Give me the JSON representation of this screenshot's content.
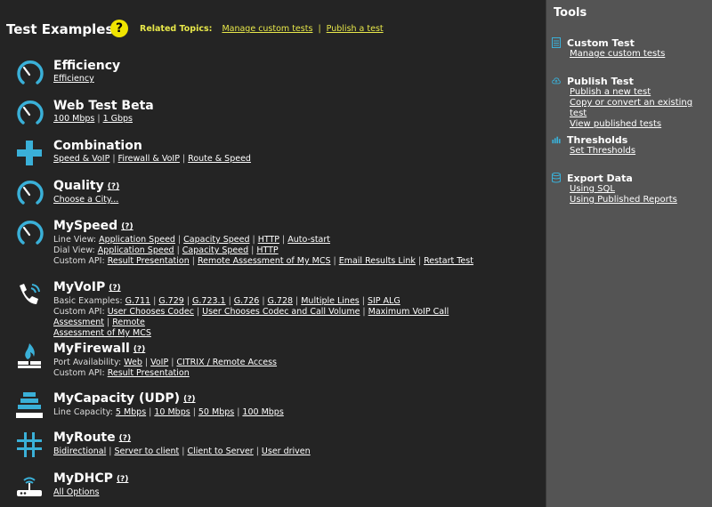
{
  "header": {
    "title": "Test Examples",
    "help_glyph": "?",
    "related_label": "Related Topics:",
    "related_links": [
      "Manage custom tests",
      "Publish a test"
    ]
  },
  "q_marker": "(?)",
  "items": {
    "efficiency": {
      "title": "Efficiency",
      "links": [
        "Efficiency"
      ],
      "icon": "gauge-icon"
    },
    "webtest": {
      "title": "Web Test Beta",
      "links": [
        "100 Mbps",
        "1 Gbps"
      ],
      "icon": "gauge-icon"
    },
    "combination": {
      "title": "Combination",
      "links": [
        "Speed & VoIP",
        "Firewall & VoIP",
        "Route & Speed"
      ],
      "icon": "plus-icon"
    },
    "quality": {
      "title": "Quality",
      "links": [
        "Choose a City..."
      ],
      "icon": "gauge-icon"
    },
    "myspeed": {
      "title": "MySpeed",
      "icon": "gauge-icon",
      "line_view_label": "Line View:",
      "line_view": [
        "Application Speed",
        "Capacity Speed",
        "HTTP",
        "Auto-start"
      ],
      "dial_view_label": "Dial View:",
      "dial_view": [
        "Application Speed",
        "Capacity Speed",
        "HTTP"
      ],
      "custom_api_label": "Custom API:",
      "custom_api": [
        "Result Presentation",
        "Remote Assessment of My MCS",
        "Email Results Link",
        "Restart Test"
      ]
    },
    "myvoip": {
      "title": "MyVoIP",
      "icon": "phone-icon",
      "basic_label": "Basic Examples:",
      "basic": [
        "G.711",
        "G.729",
        "G.723.1",
        "G.726",
        "G.728",
        "Multiple Lines",
        "SIP ALG"
      ],
      "custom_api_label": "Custom API:",
      "custom_api": [
        "User Chooses Codec",
        "User Chooses Codec and Call Volume",
        "Maximum VoIP Call Assessment",
        "Remote",
        "Assessment of My MCS"
      ]
    },
    "myfirewall": {
      "title": "MyFirewall",
      "icon": "firewall-icon",
      "port_label": "Port Availability:",
      "port": [
        "Web",
        "VoIP",
        "CITRIX / Remote Access"
      ],
      "custom_api_label": "Custom API:",
      "custom_api": [
        "Result Presentation"
      ]
    },
    "mycapacity": {
      "title": "MyCapacity (UDP)",
      "icon": "capacity-icon",
      "line_label": "Line Capacity:",
      "line": [
        "5 Mbps",
        "10 Mbps",
        "50 Mbps",
        "100 Mbps"
      ]
    },
    "myroute": {
      "title": "MyRoute",
      "icon": "route-icon",
      "links": [
        "Bidirectional",
        "Server to client",
        "Client to Server",
        "User driven"
      ]
    },
    "mydhcp": {
      "title": "MyDHCP",
      "icon": "router-icon",
      "links": [
        "All Options"
      ]
    }
  },
  "sidebar": {
    "title": "Tools",
    "groups": [
      {
        "title": "Custom Test",
        "icon": "document-icon",
        "links": [
          "Manage custom tests"
        ]
      },
      {
        "title": "Publish Test",
        "icon": "cloud-upload-icon",
        "links": [
          "Publish a new test",
          "Copy or convert an existing test",
          "View published tests"
        ]
      },
      {
        "title": "Thresholds",
        "icon": "bar-chart-icon",
        "links": [
          "Set Thresholds"
        ]
      },
      {
        "title": "Export Data",
        "icon": "database-icon",
        "links": [
          "Using SQL",
          "Using Published Reports"
        ]
      }
    ]
  },
  "colors": {
    "accent": "#3ab0d8",
    "yellow": "#f0e400",
    "link_yellow": "#e8e84a",
    "sidebar_bg": "#545454",
    "main_bg": "#242424"
  }
}
